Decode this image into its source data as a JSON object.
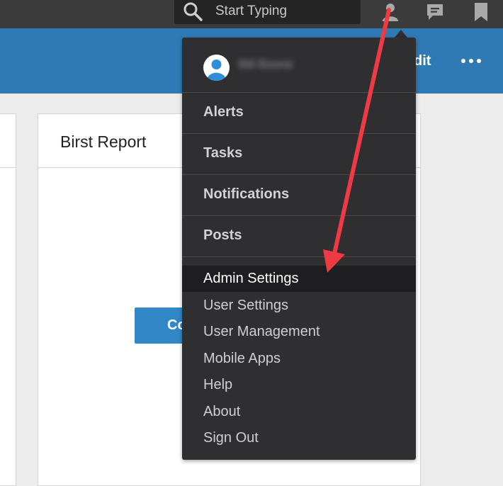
{
  "topbar": {
    "search_placeholder": "Start Typing",
    "icons": [
      "search-icon",
      "user-icon",
      "chat-icon",
      "bookmark-icon"
    ]
  },
  "header": {
    "edit_fragment": "dit",
    "more_icon": "more-icon"
  },
  "card": {
    "title": "Birst Report",
    "button_fragment": "Co"
  },
  "dropdown": {
    "username": "Bill Boone",
    "sections": [
      "Alerts",
      "Tasks",
      "Notifications",
      "Posts"
    ],
    "items": [
      "Admin Settings",
      "User Settings",
      "User Management",
      "Mobile Apps",
      "Help",
      "About",
      "Sign Out"
    ],
    "active_item": "Admin Settings"
  },
  "colors": {
    "topbar": "#3b3b3b",
    "header": "#2f7ab4",
    "dropdown": "#2f2f31",
    "annotation_arrow": "#ee3a43",
    "avatar_accent": "#2e8fd8"
  }
}
